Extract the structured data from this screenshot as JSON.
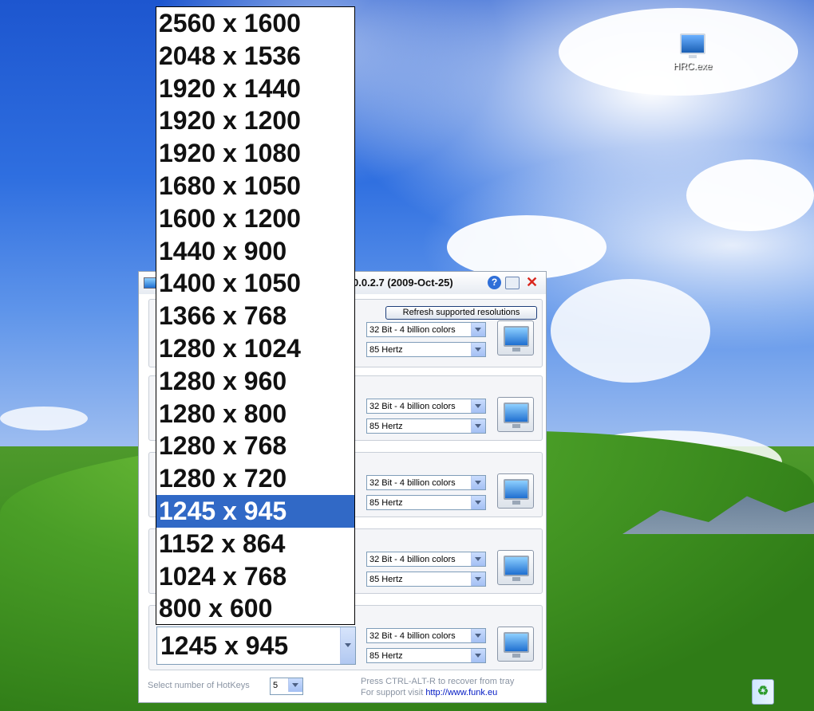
{
  "desktop": {
    "icons": [
      {
        "label": "HRC.exe",
        "icon": "monitor-icon"
      },
      {
        "label": "",
        "icon": "recycle-bin-icon"
      }
    ]
  },
  "window": {
    "title": "0.0.2.7 (2009-Oct-25)",
    "buttons": {
      "help": "?",
      "tray": "",
      "close": "✕"
    }
  },
  "refresh_label": "Refresh supported resolutions",
  "rows": [
    {
      "depth": "32 Bit - 4 billion colors",
      "rate": "85 Hertz"
    },
    {
      "depth": "32 Bit - 4 billion colors",
      "rate": "85 Hertz"
    },
    {
      "depth": "32 Bit - 4 billion colors",
      "rate": "85 Hertz"
    },
    {
      "depth": "32 Bit - 4 billion colors",
      "rate": "85 Hertz"
    },
    {
      "depth": "32 Bit - 4 billion colors",
      "rate": "85 Hertz"
    }
  ],
  "resolution_combo": {
    "value": "1245 x 945"
  },
  "resolution_options": [
    "2560 x 1600",
    "2048 x 1536",
    "1920 x 1440",
    "1920 x 1200",
    "1920 x 1080",
    "1680 x 1050",
    "1600 x 1200",
    "1440 x 900",
    "1400 x 1050",
    "1366 x 768",
    "1280 x 1024",
    "1280 x 960",
    "1280 x 800",
    "1280 x 768",
    "1280 x 720",
    "1245 x 945",
    "1152 x 864",
    "1024 x 768",
    "800 x 600"
  ],
  "selected_option": "1245 x 945",
  "footer": {
    "hotkeys_label": "Select number of HotKeys",
    "hotkeys_value": "5",
    "recover_note": "Press CTRL-ALT-R to recover from tray",
    "support_prefix": "For support visit",
    "support_link": "http://www.funk.eu"
  },
  "colors": {
    "selection": "#3169c6",
    "close_button": "#d9261c",
    "help_button": "#2f6fd8"
  }
}
